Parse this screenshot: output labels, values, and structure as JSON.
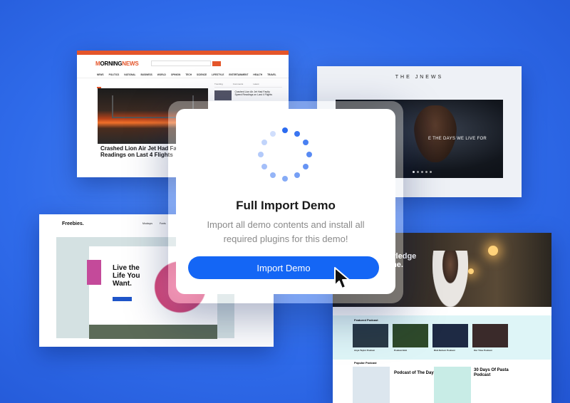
{
  "modal": {
    "title": "Full Import Demo",
    "description": "Import all demo contents and install all required plugins for this demo!",
    "button_label": "Import Demo"
  },
  "morning_news": {
    "logo_a": "M",
    "logo_b": "ORNING",
    "logo_c": "NEWS",
    "nav": [
      "NEWS",
      "POLITICS",
      "NATIONAL",
      "BUSINESS",
      "WORLD",
      "OPINION",
      "TECH",
      "SCIENCE",
      "LIFESTYLE",
      "ENTERTAINMENT",
      "HEALTH",
      "TRAVEL"
    ],
    "headline": "Crashed Lion Air Jet Had Faulty Readings on Last 4 Flights",
    "side_tabs": [
      "Trending",
      "Comments",
      "Latest"
    ],
    "side_headline": "Crashed Lion Air Jet Had Faulty Speed Readings on Last 4 Flights"
  },
  "jnews": {
    "title": "THE JNEWS",
    "slide_text": "E THE DAYS WE LIVE FOR"
  },
  "freebies": {
    "logo": "Freebies.",
    "nav": [
      "Mockups",
      "Fonts"
    ],
    "hero_text": "Live the Life You Want."
  },
  "podcast": {
    "hero_text": "wledge me.",
    "featured_label": "Featured Podcast",
    "featured": [
      "Anya Taylor Podcast",
      "Podcast Bob",
      "Rick Nelson Podcast",
      "Our Time Podcast"
    ],
    "popular_label": "Popular Podcast",
    "popular": [
      "Podcast of The Day",
      "30 Days Of Pasta Podcast"
    ]
  },
  "colors": {
    "background": "#2f6bea",
    "accent": "#1466f5",
    "morning_news_brand": "#e4552a"
  }
}
